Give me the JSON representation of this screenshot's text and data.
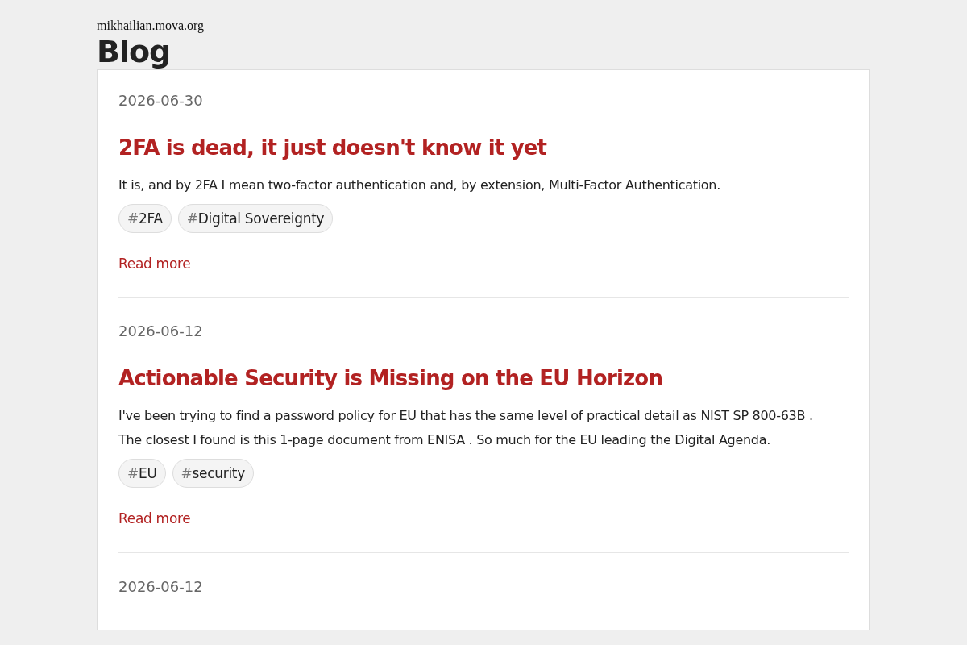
{
  "site": "mikhailian.mova.org",
  "title": "Blog",
  "posts": [
    {
      "date": "2026-06-30",
      "title": "2FA is dead, it just doesn't know it yet",
      "lines": [
        "It is, and by 2FA I mean two-factor authentication and, by extension, Multi-Factor Authentication."
      ],
      "tags": [
        {
          "prefix": "#",
          "label": "2FA"
        },
        {
          "prefix": "#",
          "label": "Digital Sovereignty"
        }
      ],
      "more": "Read more"
    },
    {
      "date": "2026-06-12",
      "title": "Actionable Security is Missing on the EU Horizon",
      "lines": [
        "I've been trying to find a password policy for EU that has the same level of practical detail as NIST SP 800-63B .",
        "The closest I found is this 1-page document from ENISA . So much for the EU leading the Digital Agenda."
      ],
      "tags": [
        {
          "prefix": "#",
          "label": "EU"
        },
        {
          "prefix": "#",
          "label": "security"
        }
      ],
      "more": "Read more"
    },
    {
      "date": "2026-06-12"
    }
  ]
}
